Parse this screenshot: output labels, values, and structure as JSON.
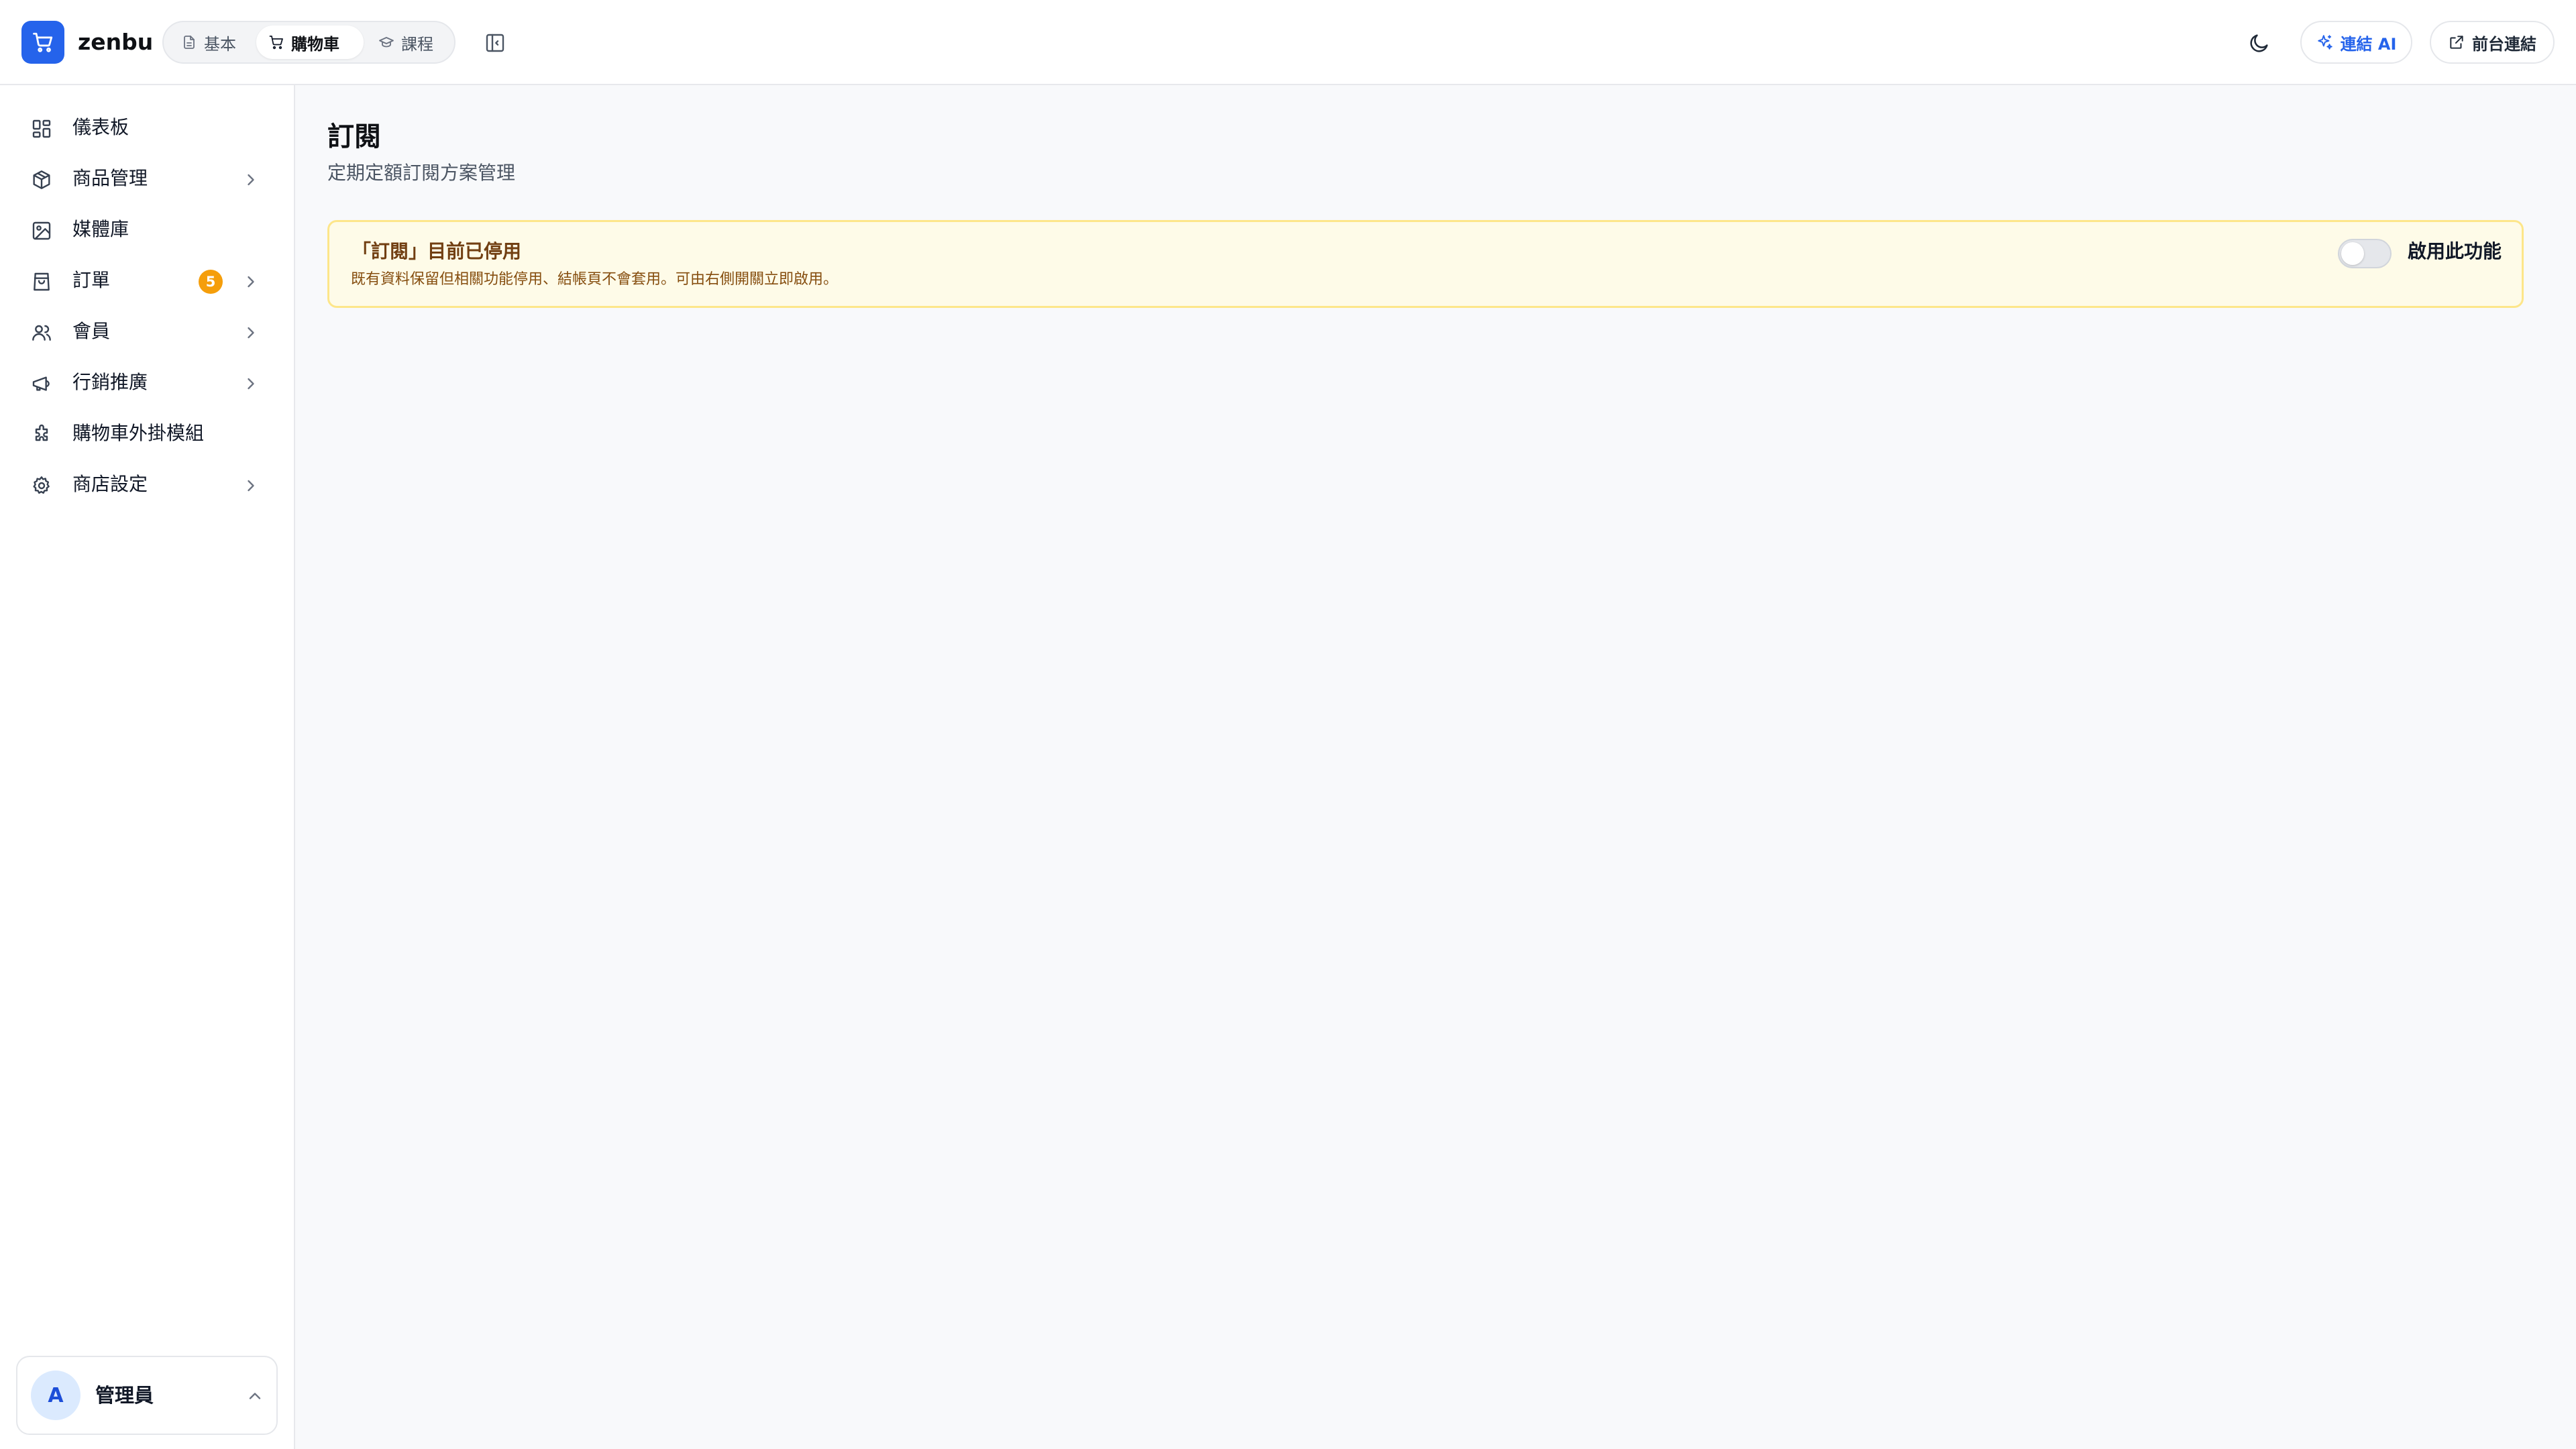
{
  "app": {
    "logo_text": "zenbu"
  },
  "header": {
    "modes": [
      {
        "label": "基本",
        "icon": "document-icon",
        "active": false
      },
      {
        "label": "購物車",
        "icon": "cart-icon",
        "active": true
      },
      {
        "label": "課程",
        "icon": "graduation-cap-icon",
        "active": false
      }
    ],
    "connect_ai_label": "連結 AI",
    "storefront_label": "前台連結"
  },
  "sidebar": {
    "items": [
      {
        "label": "儀表板",
        "icon": "dashboard-icon",
        "has_children": false
      },
      {
        "label": "商品管理",
        "icon": "package-icon",
        "has_children": true
      },
      {
        "label": "媒體庫",
        "icon": "image-icon",
        "has_children": false
      },
      {
        "label": "訂單",
        "icon": "shopping-bag-icon",
        "has_children": true,
        "badge": "5"
      },
      {
        "label": "會員",
        "icon": "users-icon",
        "has_children": true
      },
      {
        "label": "行銷推廣",
        "icon": "megaphone-icon",
        "has_children": true
      },
      {
        "label": "購物車外掛模組",
        "icon": "puzzle-icon",
        "has_children": false
      },
      {
        "label": "商店設定",
        "icon": "gear-icon",
        "has_children": true
      }
    ],
    "user": {
      "avatar_initial": "A",
      "name": "管理員"
    }
  },
  "main": {
    "title": "訂閱",
    "subtitle": "定期定額訂閱方案管理",
    "notice": {
      "title": "「訂閱」目前已停用",
      "description": "既有資料保留但相關功能停用、結帳頁不會套用。可由右側開關立即啟用。",
      "toggle_label": "啟用此功能",
      "enabled": false
    }
  },
  "colors": {
    "accent": "#2563eb",
    "badge": "#f59e0b",
    "notice_bg": "#fefbe8",
    "notice_border": "#fde68a"
  }
}
